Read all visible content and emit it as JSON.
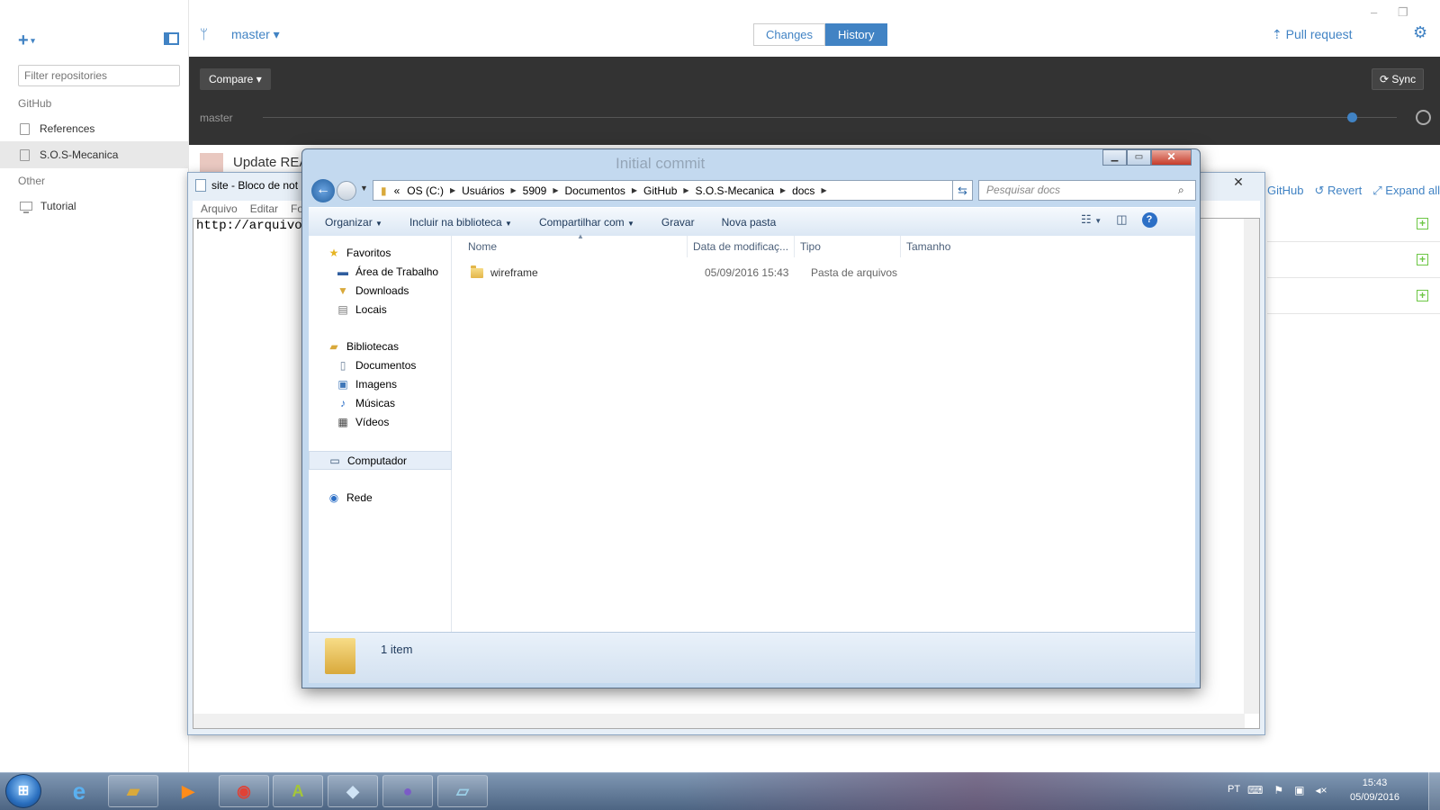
{
  "github": {
    "filter_placeholder": "Filter repositories",
    "section_github": "GitHub",
    "repo_references": "References",
    "repo_sos": "S.O.S-Mecanica",
    "section_other": "Other",
    "repo_tutorial": "Tutorial",
    "branch": "master",
    "tab_changes": "Changes",
    "tab_history": "History",
    "pull_request": "Pull request",
    "compare": "Compare",
    "sync": "Sync",
    "timeline_branch": "master",
    "commit_title": "Update REA",
    "commit_ghost": "Initial commit",
    "action_github": "GitHub",
    "action_revert": "Revert",
    "action_expand": "Expand all"
  },
  "notepad": {
    "title": "site - Bloco de not",
    "menu": [
      "Arquivo",
      "Editar",
      "Fo"
    ],
    "content": "http://arquivo."
  },
  "explorer": {
    "breadcrumb": [
      "OS (C:)",
      "Usuários",
      "5909",
      "Documentos",
      "GitHub",
      "S.O.S-Mecanica",
      "docs"
    ],
    "search_placeholder": "Pesquisar docs",
    "toolbar": {
      "organize": "Organizar",
      "include": "Incluir na biblioteca",
      "share": "Compartilhar com",
      "burn": "Gravar",
      "new_folder": "Nova pasta"
    },
    "nav": {
      "favorites": "Favoritos",
      "desktop": "Área de Trabalho",
      "downloads": "Downloads",
      "places": "Locais",
      "libraries": "Bibliotecas",
      "documents": "Documentos",
      "images": "Imagens",
      "music": "Músicas",
      "videos": "Vídeos",
      "computer": "Computador",
      "network": "Rede"
    },
    "columns": {
      "name": "Nome",
      "date": "Data de modificaç...",
      "type": "Tipo",
      "size": "Tamanho"
    },
    "files": [
      {
        "name": "wireframe",
        "date": "05/09/2016 15:43",
        "type": "Pasta de arquivos",
        "size": ""
      }
    ],
    "status": "1 item"
  },
  "taskbar": {
    "lang": "PT",
    "time": "15:43",
    "date": "05/09/2016"
  },
  "colors": {
    "github_blue": "#4183c4",
    "dark_bar": "#333333",
    "explorer_frame": "#c3d9ef"
  }
}
